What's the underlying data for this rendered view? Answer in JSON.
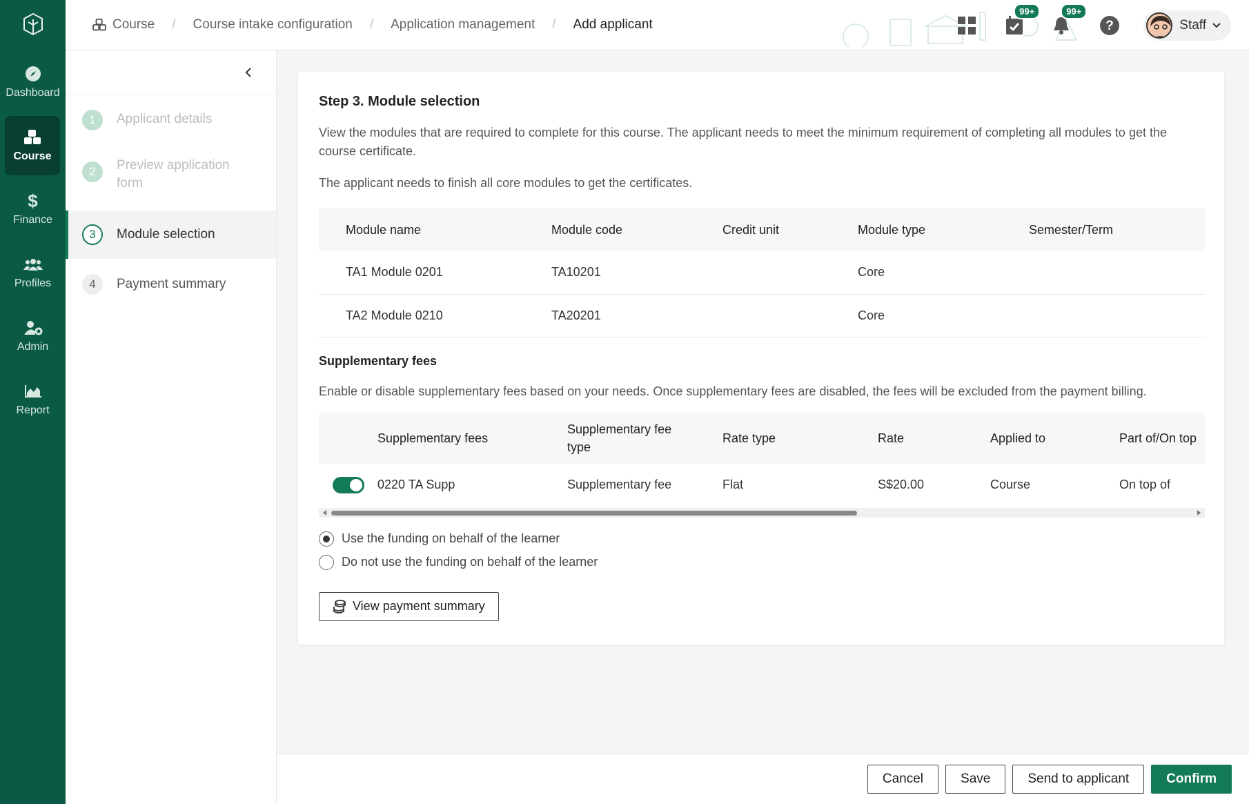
{
  "nav": {
    "items": [
      {
        "label": "Dashboard",
        "icon": "compass-icon"
      },
      {
        "label": "Course",
        "icon": "cubes-icon"
      },
      {
        "label": "Finance",
        "icon": "dollar-icon"
      },
      {
        "label": "Profiles",
        "icon": "users-icon"
      },
      {
        "label": "Admin",
        "icon": "user-gear-icon"
      },
      {
        "label": "Report",
        "icon": "area-chart-icon"
      }
    ]
  },
  "breadcrumb": {
    "items": [
      "Course",
      "Course intake configuration",
      "Application management",
      "Add applicant"
    ]
  },
  "topbar": {
    "tasks_badge": "99+",
    "notifications_badge": "99+",
    "user_label": "Staff"
  },
  "steps": [
    {
      "num": "1",
      "label": "Applicant details"
    },
    {
      "num": "2",
      "label": "Preview application form"
    },
    {
      "num": "3",
      "label": "Module selection"
    },
    {
      "num": "4",
      "label": "Payment summary"
    }
  ],
  "main": {
    "title": "Step 3. Module selection",
    "desc1": "View the modules that are required to complete for this course. The applicant needs to meet the minimum requirement of completing all modules to get the course certificate.",
    "desc2": "The applicant needs to finish all core modules to get the certificates.",
    "modules": {
      "headers": [
        "Module name",
        "Module code",
        "Credit unit",
        "Module type",
        "Semester/Term"
      ],
      "rows": [
        [
          "TA1 Module 0201",
          "TA10201",
          "",
          "Core",
          ""
        ],
        [
          "TA2 Module 0210",
          "TA20201",
          "",
          "Core",
          ""
        ]
      ]
    },
    "supp_title": "Supplementary fees",
    "supp_desc": "Enable or disable supplementary fees based on your needs. Once supplementary fees are disabled, the fees will be excluded from the payment billing.",
    "supp": {
      "headers": [
        "Supplementary fees",
        "Supplementary fee type",
        "Rate type",
        "Rate",
        "Applied to",
        "Part of/On top"
      ],
      "rows": [
        [
          "0220 TA Supp",
          "Supplementary fee",
          "Flat",
          "S$20.00",
          "Course",
          "On top of"
        ]
      ]
    },
    "radio_use": "Use the funding on behalf of the learner",
    "radio_not_use": "Do not use the funding on behalf of the learner",
    "view_payment_label": "View payment summary"
  },
  "footer": {
    "cancel": "Cancel",
    "save": "Save",
    "send": "Send to applicant",
    "confirm": "Confirm"
  },
  "colors": {
    "brand": "#0b5a45",
    "accent": "#137a56"
  }
}
